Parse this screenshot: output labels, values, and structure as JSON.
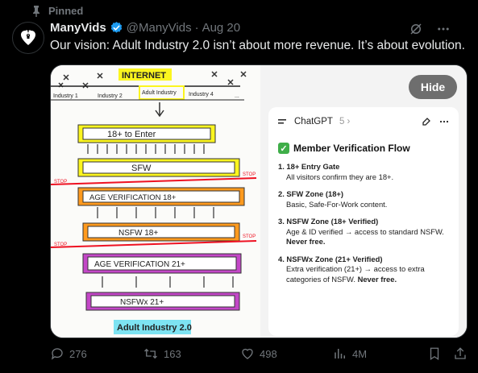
{
  "pinned": {
    "label": "Pinned"
  },
  "author": {
    "display_name": "ManyVids",
    "handle": "@ManyVids",
    "separator": "·",
    "date": "Aug 20"
  },
  "tweet": {
    "text": "Our vision: Adult Industry 2.0 isn’t about more revenue. It’s about evolution."
  },
  "media": {
    "hide_label": "Hide",
    "sketch": {
      "internet": "INTERNET",
      "industries": [
        "Industry 1",
        "Industry 2",
        "Adult Industry",
        "Industry 4",
        "..."
      ],
      "boxes": [
        "18+ to Enter",
        "SFW",
        "AGE VERIFICATION 18+",
        "NSFW 18+",
        "AGE VERIFICATION 21+",
        "NSFWx 21+"
      ],
      "stop_label": "STOP",
      "footer": "Adult Industry 2.0"
    },
    "chat": {
      "model": "ChatGPT",
      "model_version": "5 ›",
      "title": "Member Verification Flow",
      "steps": [
        {
          "title": "1.  18+ Entry Gate",
          "desc": "All visitors confirm they are 18+."
        },
        {
          "title": "2.  SFW Zone (18+)",
          "desc": "Basic, Safe-For-Work content."
        },
        {
          "title": "3.  NSFW Zone (18+ Verified)",
          "desc_pre": "Age & ID verified → access to standard NSFW. ",
          "desc_bold": "Never free."
        },
        {
          "title": "4.  NSFWx Zone (21+ Verified)",
          "desc_pre": "Extra verification (21+) → access to extra categories of NSFW. ",
          "desc_bold": "Never free."
        }
      ]
    }
  },
  "stats": {
    "replies": "276",
    "reposts": "163",
    "likes": "498",
    "views": "4M"
  },
  "colors": {
    "background": "#000000",
    "muted": "#71767b",
    "verified": "#1d9bf0",
    "check_green": "#3fae49"
  }
}
